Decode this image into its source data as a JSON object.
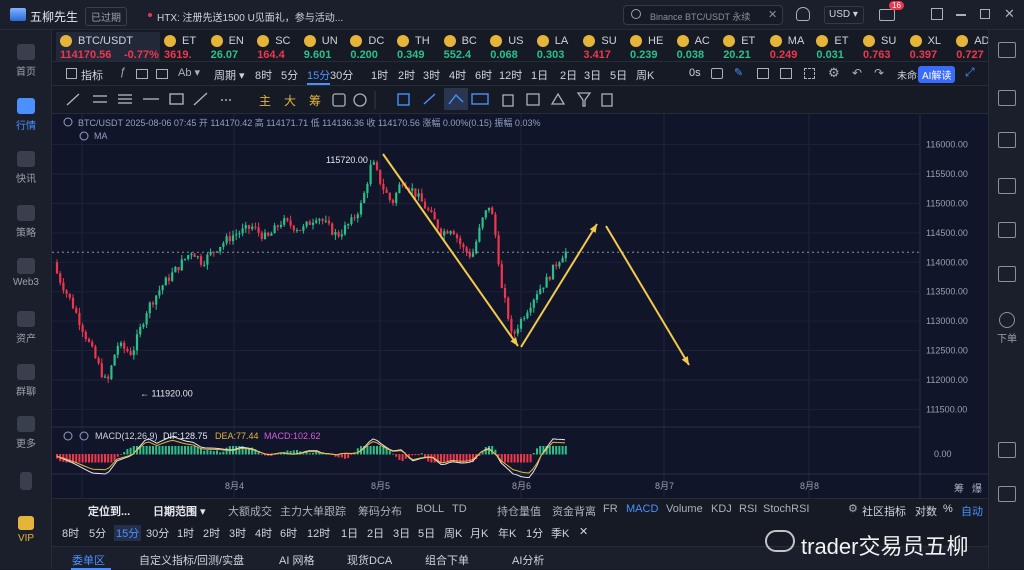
{
  "app": {
    "name": "五柳先生",
    "status": "已过期",
    "notice": "HTX: 注册先送1500 U见面礼，参与活动...",
    "search_placeholder": "Binance BTC/USDT 永续",
    "currency": "USD",
    "mail_badge": "16"
  },
  "leftnav": [
    {
      "label": "首页",
      "icon": "home-icon"
    },
    {
      "label": "行情",
      "icon": "chart-icon",
      "active": true
    },
    {
      "label": "快讯",
      "icon": "news-icon"
    },
    {
      "label": "策略",
      "icon": "robot-icon"
    },
    {
      "label": "Web3",
      "icon": "web3-icon"
    },
    {
      "label": "资产",
      "icon": "wallet-icon"
    },
    {
      "label": "群聊",
      "icon": "chat-icon"
    },
    {
      "label": "更多",
      "icon": "grid-icon"
    },
    {
      "label": "",
      "icon": "phone-icon"
    },
    {
      "label": "VIP",
      "icon": "vip-icon"
    }
  ],
  "rightnav": {
    "download_label": "下单"
  },
  "tickers": [
    {
      "sym": "BTC/USDT",
      "val": "114170.56",
      "chg": "-0.77%",
      "dir": "down"
    },
    {
      "sym": "ET",
      "val": "3619.",
      "dir": "down"
    },
    {
      "sym": "EN",
      "val": "26.07",
      "dir": "up"
    },
    {
      "sym": "SC",
      "val": "164.4",
      "dir": "down"
    },
    {
      "sym": "UN",
      "val": "9.601",
      "dir": "up"
    },
    {
      "sym": "DC",
      "val": "0.200",
      "dir": "up"
    },
    {
      "sym": "TH",
      "val": "0.349",
      "dir": "up"
    },
    {
      "sym": "BC",
      "val": "552.4",
      "dir": "up"
    },
    {
      "sym": "US",
      "val": "0.068",
      "dir": "up"
    },
    {
      "sym": "LA",
      "val": "0.303",
      "dir": "up"
    },
    {
      "sym": "SU",
      "val": "3.417",
      "dir": "down"
    },
    {
      "sym": "HE",
      "val": "0.239",
      "dir": "up"
    },
    {
      "sym": "AC",
      "val": "0.038",
      "dir": "up"
    },
    {
      "sym": "ET",
      "val": "20.21",
      "dir": "up"
    },
    {
      "sym": "MA",
      "val": "0.249",
      "dir": "down"
    },
    {
      "sym": "ET",
      "val": "0.031",
      "dir": "up"
    },
    {
      "sym": "SU",
      "val": "0.763",
      "dir": "down"
    },
    {
      "sym": "XL",
      "val": "0.397",
      "dir": "down"
    },
    {
      "sym": "AD",
      "val": "0.727",
      "dir": "down"
    }
  ],
  "toolbar1": {
    "indicator": "指标",
    "period": "周期",
    "timeframes": [
      "8时",
      "5分",
      "15分",
      "30分",
      "1时",
      "2时",
      "3时",
      "4时",
      "6时",
      "12时",
      "1日",
      "2日",
      "3日",
      "5日",
      "周K"
    ],
    "selected_tf": "15分",
    "zero_s": "0s",
    "unnamed": "未命名",
    "ai": "AI解读"
  },
  "toolbar2": {
    "chars": [
      "主",
      "大",
      "筹"
    ]
  },
  "chart": {
    "info": "BTC/USDT  2025-08-06 07:45  开 114170.42  高 114171.71  低 114136.36  收 114170.56  涨幅 0.00%(0.15)  振幅 0.03%",
    "ma_label": "MA",
    "high_label": "115720.00",
    "low_label": "← 111920.00",
    "macd_label": "MACD(12,26,9)",
    "dif": "DIF:128.75",
    "dea": "DEA:77.44",
    "macd": "MACD:102.62",
    "macd_axis": "0.00",
    "price_ticks": [
      "116000.00",
      "115500.00",
      "115000.00",
      "114500.00",
      "114000.00",
      "113500.00",
      "113000.00",
      "112500.00",
      "112000.00",
      "111500.00"
    ],
    "date_ticks": [
      "8月4",
      "8月5",
      "8月6",
      "8月7",
      "8月8"
    ],
    "right_corner": [
      "筹",
      "爆"
    ]
  },
  "chart_data": {
    "type": "candlestick",
    "title": "BTC/USDT",
    "x_ticks": [
      "8月4",
      "8月5",
      "8月6",
      "8月7",
      "8月8"
    ],
    "ylim": [
      111200,
      116300
    ],
    "annotated_high": 115720.0,
    "annotated_low": 111920.0,
    "last_close": 114170.56,
    "open": 114170.42,
    "high": 114171.71,
    "low": 114136.36,
    "change_pct": "0.00%",
    "amplitude_pct": "0.03%",
    "series": [
      {
        "name": "MACD(12,26,9)",
        "DIF": 128.75,
        "DEA": 77.44,
        "MACD": 102.62
      }
    ]
  },
  "bottombar1": {
    "locate": "定位到...",
    "range": "日期范围",
    "indicators": [
      "大额成交",
      "主力大单跟踪",
      "筹码分布",
      "BOLL",
      "TD",
      "持仓量值",
      "资金背离",
      "FR",
      "MACD",
      "Volume",
      "KDJ",
      "RSI",
      "StochRSI"
    ],
    "selected": "MACD",
    "community": "社区指标",
    "logscale": "对数",
    "percent": "%",
    "auto": "自动"
  },
  "bottombar2": {
    "tfs": [
      "8时",
      "5分",
      "15分",
      "30分",
      "1时",
      "2时",
      "3时",
      "4时",
      "6时",
      "12时",
      "1日",
      "2日",
      "3日",
      "5日",
      "周K",
      "月K",
      "年K",
      "1分",
      "季K"
    ],
    "selected": "15分",
    "close": "✕"
  },
  "tabs": [
    "委单区",
    "自定义指标/回测/实盘",
    "AI 网格",
    "现货DCA",
    "组合下单",
    "AI分析"
  ],
  "watermark": "trader交易员五柳"
}
